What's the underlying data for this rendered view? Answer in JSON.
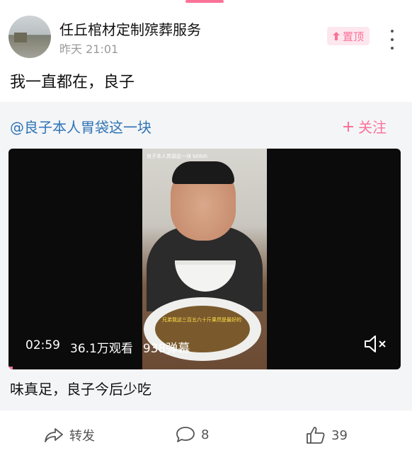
{
  "post": {
    "author": "任丘棺材定制殡葬服务",
    "time": "昨天 21:01",
    "pin_label": "置顶",
    "text": "我一直都在，良子"
  },
  "repost": {
    "author": "@良子本人胃袋这一块",
    "follow_label": "关注",
    "video": {
      "duration": "02:59",
      "views": "36.1万观看",
      "danmaku": "938弹幕",
      "frame_caption": "良子本人胃袋这一块 bilibili",
      "frame_subtitle": "兄弟我这三百五六十斤果然是最好的",
      "progress": 0.01
    },
    "text": "味真足，良子今后少吃"
  },
  "actions": {
    "forward_label": "转发",
    "comment_count": "8",
    "like_count": "39"
  },
  "colors": {
    "accent": "#fb7299",
    "link": "#2e74b5",
    "card_bg": "#f4f5f7"
  },
  "icons": [
    "pin-icon",
    "more-icon",
    "plus-icon",
    "mute-icon",
    "forward-icon",
    "comment-icon",
    "like-icon"
  ]
}
